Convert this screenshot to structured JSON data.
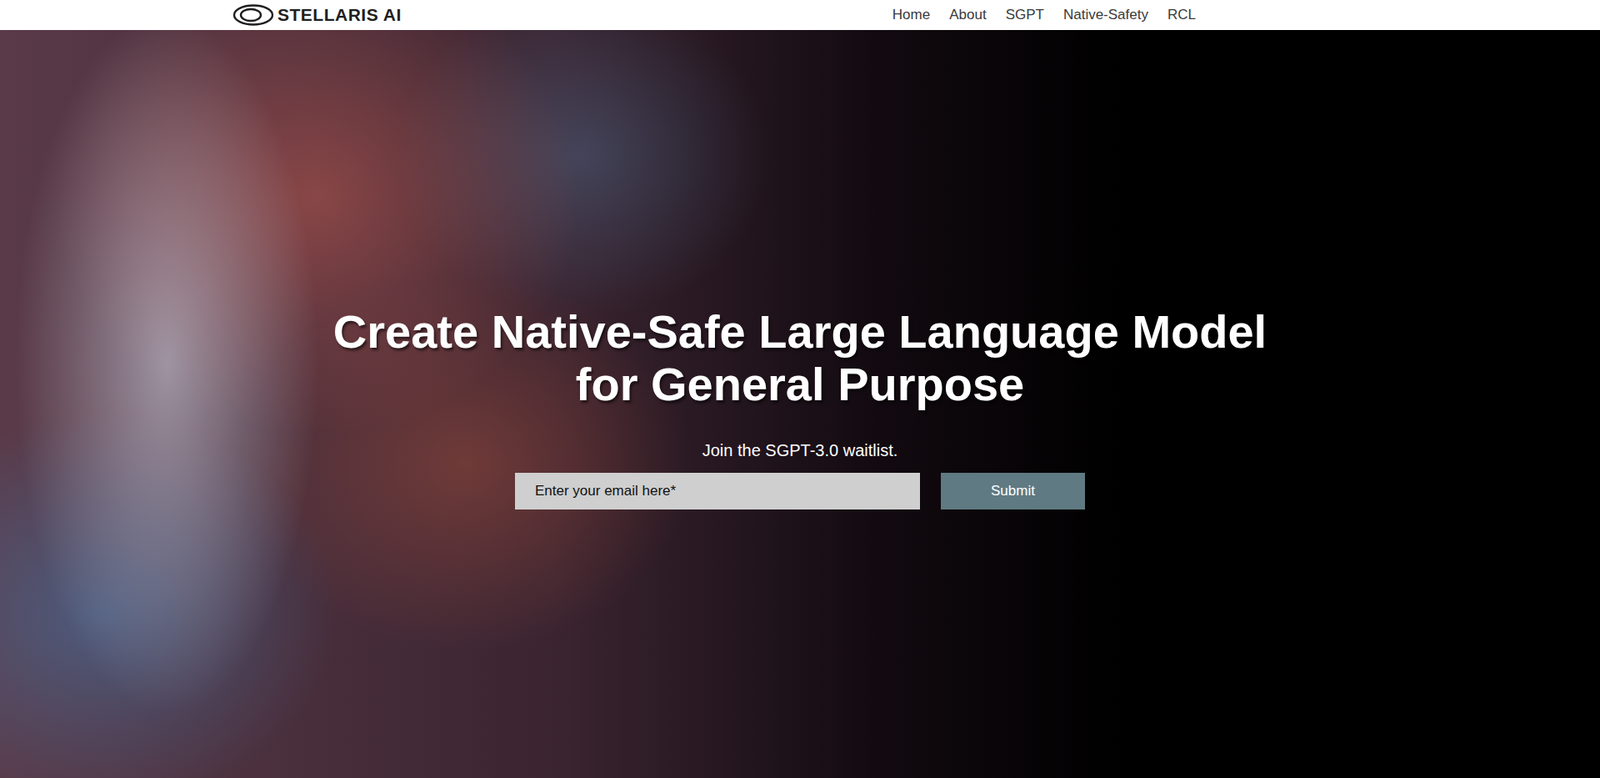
{
  "header": {
    "logo": {
      "text": "STELLARIS AI"
    },
    "nav": {
      "items": [
        {
          "label": "Home"
        },
        {
          "label": "About"
        },
        {
          "label": "SGPT"
        },
        {
          "label": "Native-Safety"
        },
        {
          "label": "RCL"
        }
      ]
    }
  },
  "hero": {
    "title_lines": [
      "Create Native-Safe Large Language Model",
      "for General Purpose"
    ],
    "subtitle": "Join the SGPT-3.0 waitlist.",
    "email": {
      "placeholder": "Enter your email here*"
    },
    "button": "Submit"
  }
}
